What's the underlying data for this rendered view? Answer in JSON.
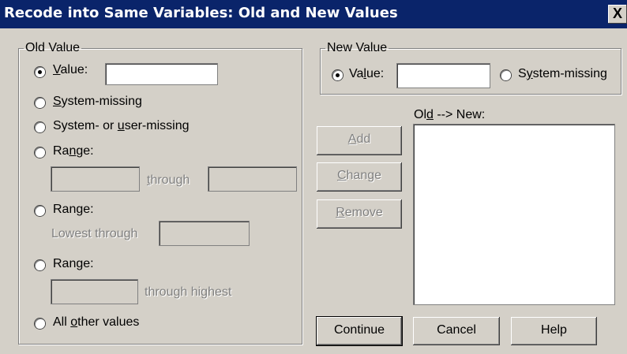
{
  "window": {
    "title": "Recode into Same Variables: Old and New Values",
    "close_glyph": "X"
  },
  "old_value": {
    "group_label": "Old Value",
    "value_label": "Value:",
    "value_input": "",
    "system_missing_label": "System-missing",
    "system_user_missing_label": "System- or user-missing",
    "range1_label": "Range:",
    "through_label": "through",
    "range2_label": "Range:",
    "lowest_through_label": "Lowest through",
    "range3_label": "Range:",
    "through_highest_label": "through highest",
    "all_other_label": "All other values",
    "selected": "value"
  },
  "new_value": {
    "group_label": "New Value",
    "value_label": "Value:",
    "value_input": "",
    "system_missing_label": "System-missing",
    "selected": "value"
  },
  "mapping": {
    "list_label": "Old --> New:",
    "items": []
  },
  "buttons": {
    "add": "Add",
    "change": "Change",
    "remove": "Remove",
    "continue": "Continue",
    "cancel": "Cancel",
    "help": "Help"
  }
}
